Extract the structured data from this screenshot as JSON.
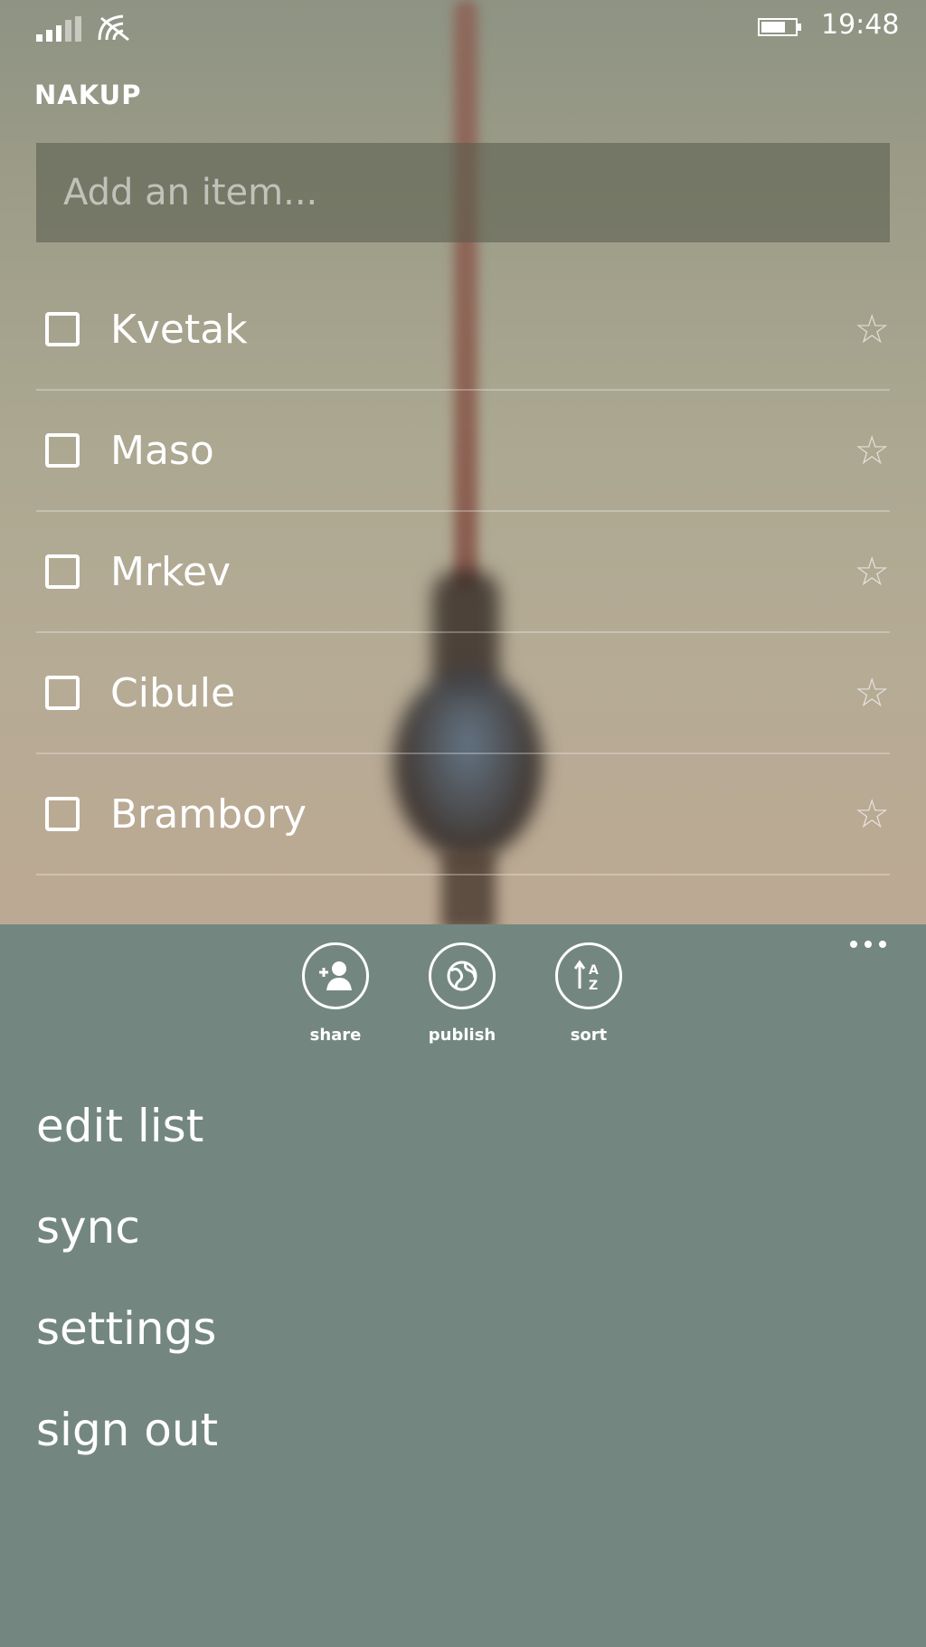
{
  "status_bar": {
    "time": "19:48",
    "signal": "signal-icon",
    "wifi": "wifi-icon",
    "battery": "battery-icon"
  },
  "list": {
    "title": "NAKUP",
    "add_placeholder": "Add an item...",
    "items": [
      {
        "label": "Kvetak",
        "checked": false,
        "starred": false
      },
      {
        "label": "Maso",
        "checked": false,
        "starred": false
      },
      {
        "label": "Mrkev",
        "checked": false,
        "starred": false
      },
      {
        "label": "Cibule",
        "checked": false,
        "starred": false
      },
      {
        "label": "Brambory",
        "checked": false,
        "starred": false
      }
    ]
  },
  "app_bar": {
    "actions": [
      {
        "label": "share",
        "icon": "share-icon"
      },
      {
        "label": "publish",
        "icon": "publish-icon"
      },
      {
        "label": "sort",
        "icon": "sort-icon"
      }
    ],
    "menu": [
      "edit list",
      "sync",
      "settings",
      "sign out"
    ],
    "more_icon": "more-icon"
  },
  "colors": {
    "app_bar_bg": "#738780",
    "text": "#ffffff"
  }
}
